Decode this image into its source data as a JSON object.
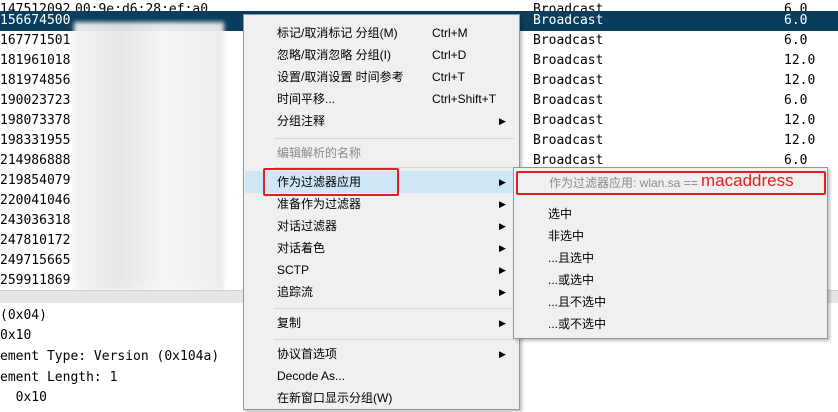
{
  "packet_rows": [
    {
      "time": "147512092",
      "addr": "00:9e:d6:28:ef:a0",
      "proto": "Broadcast",
      "rate": "6.0",
      "selected": false
    },
    {
      "time": "156674500",
      "addr": "",
      "proto": "Broadcast",
      "rate": "6.0",
      "selected": true
    },
    {
      "time": "167771501",
      "addr": "",
      "proto": "Broadcast",
      "rate": "6.0",
      "selected": false
    },
    {
      "time": "181961018",
      "addr": "",
      "proto": "Broadcast",
      "rate": "12.0",
      "selected": false
    },
    {
      "time": "181974856",
      "addr": "",
      "proto": "Broadcast",
      "rate": "12.0",
      "selected": false
    },
    {
      "time": "190023723",
      "addr": "",
      "proto": "Broadcast",
      "rate": "6.0",
      "selected": false
    },
    {
      "time": "198073378",
      "addr": "",
      "proto": "Broadcast",
      "rate": "12.0",
      "selected": false
    },
    {
      "time": "198331955",
      "addr": "",
      "proto": "Broadcast",
      "rate": "12.0",
      "selected": false
    },
    {
      "time": "214986888",
      "addr": "",
      "proto": "Broadcast",
      "rate": "6.0",
      "selected": false
    },
    {
      "time": "219854079",
      "addr": "",
      "proto": "",
      "rate": "",
      "selected": false
    },
    {
      "time": "220041046",
      "addr": "",
      "proto": "",
      "rate": "",
      "selected": false
    },
    {
      "time": "243036318",
      "addr": "",
      "proto": "",
      "rate": "",
      "selected": false
    },
    {
      "time": "247810172",
      "addr": "",
      "proto": "",
      "rate": "",
      "selected": false
    },
    {
      "time": "249715665",
      "addr": "",
      "proto": "",
      "rate": "",
      "selected": false
    },
    {
      "time": "259911869",
      "addr": "",
      "proto": "",
      "rate": "",
      "selected": false
    }
  ],
  "details": [
    "(0x04)",
    "0x10",
    "ement Type: Version (0x104a)",
    "ement Length: 1",
    "  0x10"
  ],
  "context_menu": {
    "items": [
      {
        "label": "标记/取消标记 分组(M)",
        "shortcut": "Ctrl+M",
        "submenu": false,
        "disabled": false
      },
      {
        "label": "忽略/取消忽略 分组(I)",
        "shortcut": "Ctrl+D",
        "submenu": false,
        "disabled": false
      },
      {
        "label": "设置/取消设置 时间参考",
        "shortcut": "Ctrl+T",
        "submenu": false,
        "disabled": false
      },
      {
        "label": "时间平移...",
        "shortcut": "Ctrl+Shift+T",
        "submenu": false,
        "disabled": false
      },
      {
        "label": "分组注释",
        "shortcut": "",
        "submenu": true,
        "disabled": false
      },
      {
        "label": "编辑解析的名称",
        "shortcut": "",
        "submenu": false,
        "disabled": true
      },
      {
        "label": "作为过滤器应用",
        "shortcut": "",
        "submenu": true,
        "disabled": false
      },
      {
        "label": "准备作为过滤器",
        "shortcut": "",
        "submenu": true,
        "disabled": false
      },
      {
        "label": "对话过滤器",
        "shortcut": "",
        "submenu": true,
        "disabled": false
      },
      {
        "label": "对话着色",
        "shortcut": "",
        "submenu": true,
        "disabled": false
      },
      {
        "label": "SCTP",
        "shortcut": "",
        "submenu": true,
        "disabled": false
      },
      {
        "label": "追踪流",
        "shortcut": "",
        "submenu": true,
        "disabled": false
      },
      {
        "label": "复制",
        "shortcut": "",
        "submenu": true,
        "disabled": false
      },
      {
        "label": "协议首选项",
        "shortcut": "",
        "submenu": true,
        "disabled": false
      },
      {
        "label": "Decode As...",
        "shortcut": "",
        "submenu": false,
        "disabled": false
      },
      {
        "label": "在新窗口显示分组(W)",
        "shortcut": "",
        "submenu": false,
        "disabled": false
      }
    ]
  },
  "submenu": {
    "header": "作为过滤器应用: wlan.sa ==",
    "annotation": "macaddress",
    "items": [
      "选中",
      "非选中",
      "...且选中",
      "...或选中",
      "...且不选中",
      "...或不选中"
    ]
  },
  "colors": {
    "selected_row": "#0b3d5c",
    "highlight": "#cfe6f7",
    "annotation_red": "#e02020"
  }
}
